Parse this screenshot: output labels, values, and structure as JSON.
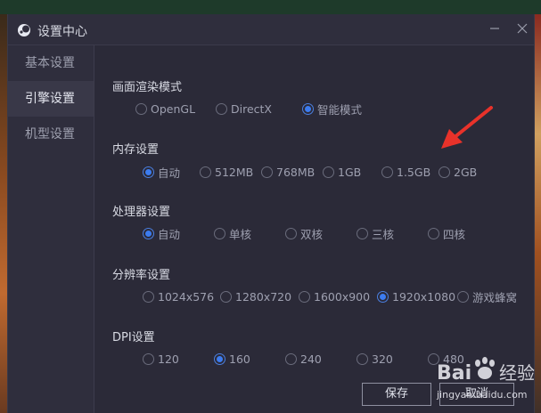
{
  "window": {
    "title": "设置中心"
  },
  "sidebar": {
    "items": [
      {
        "label": "基本设置",
        "active": false
      },
      {
        "label": "引擎设置",
        "active": true
      },
      {
        "label": "机型设置",
        "active": false
      }
    ]
  },
  "sections": {
    "render": {
      "title": "画面渲染模式",
      "options": [
        "OpenGL",
        "DirectX",
        "智能模式"
      ],
      "selected": "智能模式"
    },
    "memory": {
      "title": "内存设置",
      "options": [
        "自动",
        "512MB",
        "768MB",
        "1GB",
        "1.5GB",
        "2GB"
      ],
      "selected": "自动"
    },
    "cpu": {
      "title": "处理器设置",
      "options": [
        "自动",
        "单核",
        "双核",
        "三核",
        "四核"
      ],
      "selected": "自动"
    },
    "resolution": {
      "title": "分辨率设置",
      "options": [
        "1024x576",
        "1280x720",
        "1600x900",
        "1920x1080",
        "游戏蜂窝"
      ],
      "selected": "1920x1080"
    },
    "dpi": {
      "title": "DPI设置",
      "options": [
        "120",
        "160",
        "240",
        "320",
        "480"
      ],
      "selected": "160"
    }
  },
  "buttons": {
    "save": "保存",
    "cancel": "取消"
  },
  "annotation": {
    "color": "#e8322a"
  },
  "watermark": {
    "logo_text": "Bai经验",
    "url": "jingyan.baidu.com"
  },
  "colors": {
    "accent": "#3c7cf0",
    "window_bg": "#2b2a38"
  }
}
